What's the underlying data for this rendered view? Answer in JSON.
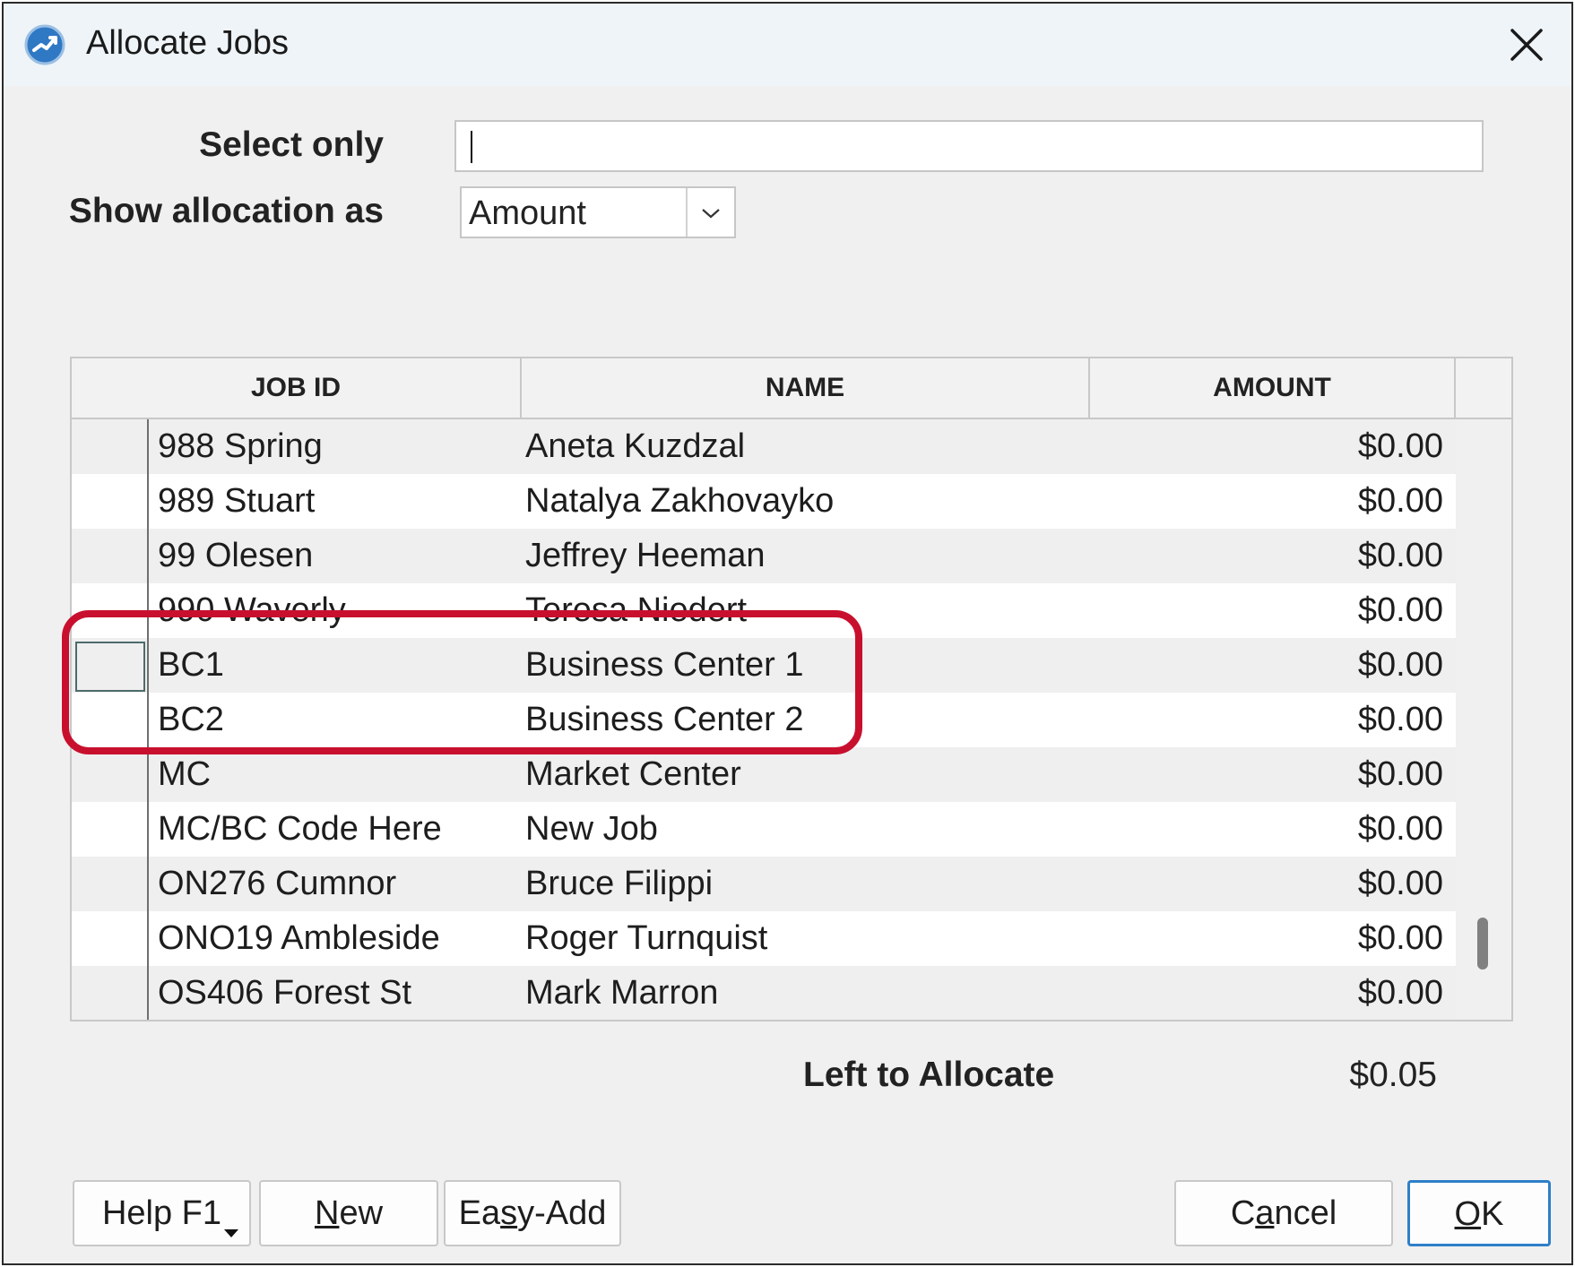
{
  "window": {
    "title": "Allocate Jobs",
    "app_icon": "app-logo-icon",
    "close_icon": "close-icon"
  },
  "filters": {
    "select_only_label": "Select only",
    "select_only_value": "",
    "show_allocation_label": "Show allocation as",
    "show_allocation_value": "Amount"
  },
  "grid": {
    "columns": [
      "JOB ID",
      "NAME",
      "AMOUNT"
    ],
    "rows": [
      {
        "job_id": "988 Spring",
        "name": "Aneta Kuzdzal",
        "amount": "$0.00"
      },
      {
        "job_id": "989 Stuart",
        "name": "Natalya Zakhovayko",
        "amount": "$0.00"
      },
      {
        "job_id": "99 Olesen",
        "name": "Jeffrey Heeman",
        "amount": "$0.00"
      },
      {
        "job_id": "990 Waverly",
        "name": "Teresa Niedert",
        "amount": "$0.00"
      },
      {
        "job_id": "BC1",
        "name": "Business Center 1",
        "amount": "$0.00"
      },
      {
        "job_id": "BC2",
        "name": "Business Center 2",
        "amount": "$0.00"
      },
      {
        "job_id": "MC",
        "name": "Market Center",
        "amount": "$0.00"
      },
      {
        "job_id": "MC/BC Code Here",
        "name": "New Job",
        "amount": "$0.00"
      },
      {
        "job_id": "ON276 Cumnor",
        "name": "Bruce Filippi",
        "amount": "$0.00"
      },
      {
        "job_id": "ONO19 Ambleside",
        "name": "Roger Turnquist",
        "amount": "$0.00"
      },
      {
        "job_id": "OS406 Forest St",
        "name": "Mark Marron",
        "amount": "$0.00"
      }
    ]
  },
  "summary": {
    "left_to_allocate_label": "Left to Allocate",
    "left_to_allocate_value": "$0.05"
  },
  "buttons": {
    "help": "Help F1",
    "new_prefix": "",
    "new_mnemonic": "N",
    "new_rest": "ew",
    "easy_prefix": "Ea",
    "easy_mnemonic": "s",
    "easy_rest": "y-Add",
    "cancel_prefix": "C",
    "cancel_mnemonic": "a",
    "cancel_rest": "ncel",
    "ok_prefix": "",
    "ok_mnemonic": "O",
    "ok_rest": "K"
  },
  "colors": {
    "highlight": "#c8102e",
    "ok_border": "#2e7fc8",
    "icon_blue": "#2f78c4"
  }
}
